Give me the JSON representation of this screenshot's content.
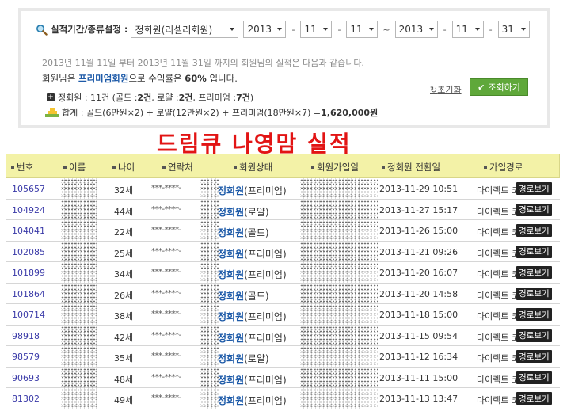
{
  "filter": {
    "label": "실적기간/종류설정 :",
    "member_type": "정회원(리셀러회원)",
    "from_year": "2013",
    "from_month": "11",
    "from_day": "11",
    "tilde": "~",
    "to_year": "2013",
    "to_month": "11",
    "to_day": "31",
    "dash": "-",
    "reset_label": "초기화",
    "query_label": "조회하기"
  },
  "summary": {
    "desc_line": "2013년 11월 11일 부터 2013년 11월 31일 까지의 회원님의 실적은 다음과 같습니다.",
    "grade_prefix": "회원님은 ",
    "grade": "프리미엄회원",
    "grade_mid": "으로 수익률은 ",
    "rate": "60%",
    "grade_suffix": " 입니다.",
    "count_prefix": "정회원 : 11건 (골드 : ",
    "gold_count": "2건",
    "count_mid1": ", 로얄 : ",
    "royal_count": "2건",
    "count_mid2": ", 프리미엄 : ",
    "premium_count": "7건",
    "count_suffix": ")",
    "total_prefix": "합계 : 골드(6만원×2) + 로얄(12만원×2) + 프리미엄(18만원×7) = ",
    "total_value": "1,620,000원"
  },
  "headline": "드림큐 나영맘 실적",
  "table": {
    "headers": [
      "번호",
      "이름",
      "나이",
      "연락처",
      "회원상태",
      "회원가입일",
      "정회원 전환일",
      "가입경로"
    ],
    "route_button": "경로보기",
    "rows": [
      {
        "no": "105657",
        "age": "32세",
        "tel": "***-****-",
        "status_main": "정회원",
        "status_sub": "(프리미엄)",
        "convert": "2013-11-29 10:51",
        "path": "다이렉트 코드"
      },
      {
        "no": "104924",
        "age": "44세",
        "tel": "***-****-",
        "status_main": "정회원",
        "status_sub": "(로얄)",
        "convert": "2013-11-27 15:17",
        "path": "다이렉트 코드"
      },
      {
        "no": "104041",
        "age": "22세",
        "tel": "***-****-",
        "status_main": "정회원",
        "status_sub": "(골드)",
        "convert": "2013-11-26 15:00",
        "path": "다이렉트 코드"
      },
      {
        "no": "102085",
        "age": "25세",
        "tel": "***-****-",
        "status_main": "정회원",
        "status_sub": "(프리미엄)",
        "convert": "2013-11-21 09:26",
        "path": "다이렉트 코드"
      },
      {
        "no": "101899",
        "age": "34세",
        "tel": "***-****-",
        "status_main": "정회원",
        "status_sub": "(프리미엄)",
        "convert": "2013-11-20 16:07",
        "path": "다이렉트 코드"
      },
      {
        "no": "101864",
        "age": "26세",
        "tel": "***-****-",
        "status_main": "정회원",
        "status_sub": "(골드)",
        "convert": "2013-11-20 14:58",
        "path": "다이렉트 코드"
      },
      {
        "no": "100714",
        "age": "38세",
        "tel": "***-****-",
        "status_main": "정회원",
        "status_sub": "(프리미엄)",
        "convert": "2013-11-18 15:00",
        "path": "다이렉트 코드"
      },
      {
        "no": "98918",
        "age": "42세",
        "tel": "***-****-",
        "status_main": "정회원",
        "status_sub": "(프리미엄)",
        "convert": "2013-11-15 09:54",
        "path": "다이렉트 코드"
      },
      {
        "no": "98579",
        "age": "35세",
        "tel": "***-****-",
        "status_main": "정회원",
        "status_sub": "(로얄)",
        "convert": "2013-11-12 16:34",
        "path": "다이렉트 코드"
      },
      {
        "no": "90693",
        "age": "48세",
        "tel": "***-****-",
        "status_main": "정회원",
        "status_sub": "(프리미엄)",
        "convert": "2013-11-11 15:00",
        "path": "다이렉트 코드"
      },
      {
        "no": "81302",
        "age": "49세",
        "tel": "***-****-",
        "status_main": "정회원",
        "status_sub": "(프리미엄)",
        "convert": "2013-11-13 13:47",
        "path": "다이렉트 코드"
      }
    ]
  },
  "colors": {
    "headline": "#e21414",
    "header_bg": "#f3f2a7",
    "accent_blue": "#1d5aa8",
    "button_green": "#5fa83a"
  }
}
